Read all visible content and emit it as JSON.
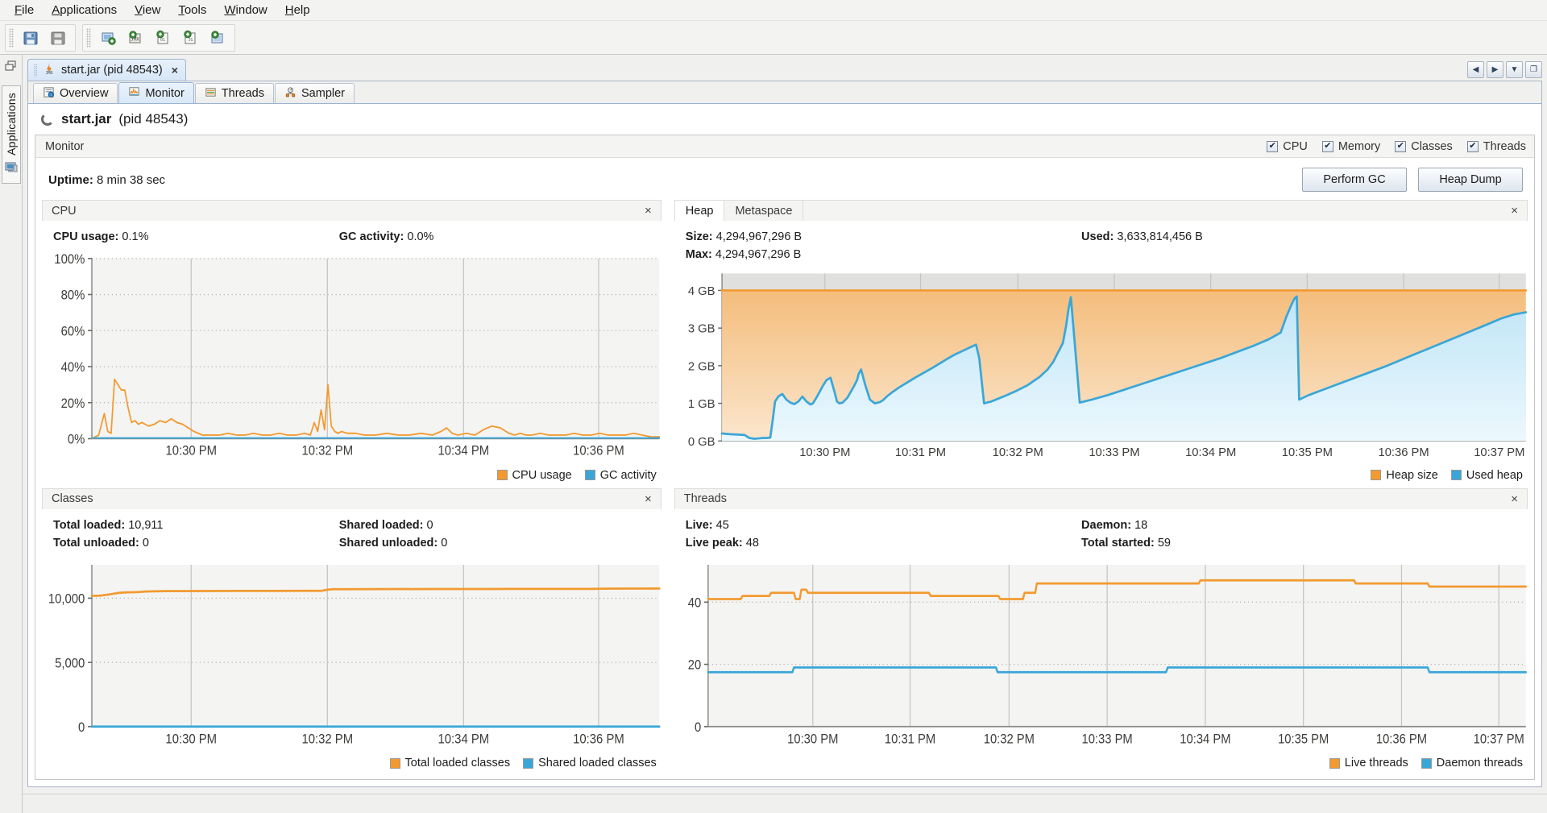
{
  "menu": {
    "items": [
      {
        "label": "File",
        "accel": "F"
      },
      {
        "label": "Applications",
        "accel": "A"
      },
      {
        "label": "View",
        "accel": "V"
      },
      {
        "label": "Tools",
        "accel": "T"
      },
      {
        "label": "Window",
        "accel": "W"
      },
      {
        "label": "Help",
        "accel": "H"
      }
    ]
  },
  "toolbar": {
    "group1": [
      "save-icon",
      "save-all-icon"
    ],
    "group2": [
      "add-local-host-icon",
      "add-jmx-connection-icon",
      "add-remote-host-icon",
      "add-vm-coredump-icon",
      "add-snapshot-icon"
    ]
  },
  "left_rail": {
    "window_icon": "windows-icon",
    "tab_label": "Applications",
    "tab_icon": "computer-icon"
  },
  "doc_tab": {
    "icon": "jmx-icon",
    "label": "start.jar (pid 48543)",
    "close": "×",
    "nav": [
      "◀",
      "▶",
      "▼",
      "❐"
    ]
  },
  "subtabs": [
    {
      "label": "Overview",
      "icon": "overview-icon",
      "active": false
    },
    {
      "label": "Monitor",
      "icon": "monitor-icon",
      "active": true
    },
    {
      "label": "Threads",
      "icon": "threads-icon",
      "active": false
    },
    {
      "label": "Sampler",
      "icon": "sampler-icon",
      "active": false
    }
  ],
  "app_header": {
    "name": "start.jar",
    "pid": "(pid 48543)"
  },
  "monitor": {
    "title": "Monitor",
    "checkboxes": [
      {
        "label": "CPU",
        "checked": true
      },
      {
        "label": "Memory",
        "checked": true
      },
      {
        "label": "Classes",
        "checked": true
      },
      {
        "label": "Threads",
        "checked": true
      }
    ],
    "uptime_label": "Uptime:",
    "uptime_value": "8 min 38 sec",
    "buttons": [
      {
        "label": "Perform GC"
      },
      {
        "label": "Heap Dump"
      }
    ]
  },
  "colors": {
    "orange": "#f29a30",
    "orange_fill": "#f6c98a",
    "blue": "#3aa6d8",
    "blue_fill": "#b8e2f5",
    "grid": "#cfcfcd",
    "plot_bg": "#f4f4f3"
  },
  "cards": {
    "cpu": {
      "title": "CPU",
      "close": "×",
      "stats": [
        {
          "label": "CPU usage:",
          "value": "0.1%"
        },
        {
          "label": "GC activity:",
          "value": "0.0%"
        }
      ]
    },
    "heap": {
      "tabs": [
        {
          "label": "Heap",
          "active": true
        },
        {
          "label": "Metaspace",
          "active": false
        }
      ],
      "close": "×",
      "stats": [
        {
          "label": "Size:",
          "value": "4,294,967,296 B"
        },
        {
          "label": "Max:",
          "value": "4,294,967,296 B"
        },
        {
          "label": "Used:",
          "value": "3,633,814,456 B"
        }
      ]
    },
    "classes": {
      "title": "Classes",
      "close": "×",
      "stats": [
        {
          "label": "Total loaded:",
          "value": "10,911"
        },
        {
          "label": "Total unloaded:",
          "value": "0"
        },
        {
          "label": "Shared loaded:",
          "value": "0"
        },
        {
          "label": "Shared unloaded:",
          "value": "0"
        }
      ]
    },
    "threads": {
      "title": "Threads",
      "close": "×",
      "stats": [
        {
          "label": "Live:",
          "value": "45"
        },
        {
          "label": "Live peak:",
          "value": "48"
        },
        {
          "label": "Daemon:",
          "value": "18"
        },
        {
          "label": "Total started:",
          "value": "59"
        }
      ]
    }
  },
  "chart_data": [
    {
      "id": "cpu",
      "type": "area",
      "title": "CPU",
      "xlabel": "",
      "ylabel": "",
      "ylim": [
        0,
        100
      ],
      "yticks": [
        0,
        20,
        40,
        60,
        80,
        100
      ],
      "yticklabels": [
        "0%",
        "20%",
        "40%",
        "60%",
        "80%",
        "100%"
      ],
      "xticklabels": [
        "10:30 PM",
        "10:32 PM",
        "10:34 PM",
        "10:36 PM"
      ],
      "xtickpos": [
        0.175,
        0.415,
        0.655,
        0.893
      ],
      "grid": true,
      "legend": [
        {
          "name": "CPU usage",
          "color": "#f29a30"
        },
        {
          "name": "GC activity",
          "color": "#3aa6d8"
        }
      ],
      "series": [
        {
          "name": "CPU usage",
          "color": "#f29a30",
          "x": [
            0.0,
            0.012,
            0.022,
            0.028,
            0.034,
            0.04,
            0.046,
            0.052,
            0.058,
            0.064,
            0.07,
            0.076,
            0.082,
            0.088,
            0.094,
            0.1,
            0.11,
            0.12,
            0.13,
            0.14,
            0.15,
            0.16,
            0.17,
            0.18,
            0.195,
            0.21,
            0.225,
            0.24,
            0.255,
            0.27,
            0.285,
            0.3,
            0.315,
            0.33,
            0.345,
            0.36,
            0.375,
            0.385,
            0.392,
            0.398,
            0.404,
            0.41,
            0.416,
            0.422,
            0.428,
            0.434,
            0.44,
            0.45,
            0.465,
            0.48,
            0.5,
            0.52,
            0.54,
            0.56,
            0.58,
            0.6,
            0.615,
            0.625,
            0.635,
            0.645,
            0.66,
            0.675,
            0.69,
            0.705,
            0.72,
            0.735,
            0.745,
            0.755,
            0.765,
            0.775,
            0.79,
            0.805,
            0.82,
            0.835,
            0.85,
            0.865,
            0.88,
            0.895,
            0.91,
            0.925,
            0.94,
            0.955,
            0.97,
            0.985,
            1.0
          ],
          "values": [
            0,
            2,
            14,
            4,
            3,
            33,
            30,
            27,
            27,
            17,
            9,
            10,
            8,
            9,
            8,
            7,
            8,
            10,
            9,
            11,
            9,
            8,
            6,
            4,
            2,
            2,
            2,
            3,
            2,
            2,
            3,
            2,
            2,
            3,
            2,
            2,
            3,
            2,
            9,
            4,
            16,
            5,
            30,
            7,
            4,
            3,
            4,
            3,
            3,
            2,
            2,
            3,
            2,
            2,
            3,
            2,
            4,
            6,
            3,
            2,
            3,
            2,
            5,
            7,
            6,
            3,
            2,
            3,
            2,
            2,
            3,
            2,
            2,
            2,
            3,
            2,
            2,
            3,
            2,
            2,
            2,
            3,
            2,
            1,
            1
          ]
        },
        {
          "name": "GC activity",
          "color": "#3aa6d8",
          "x": [
            0,
            1
          ],
          "values": [
            0.4,
            0.4
          ]
        }
      ]
    },
    {
      "id": "heap",
      "type": "area",
      "title": "Heap",
      "ylim": [
        0,
        4.45
      ],
      "yticks": [
        0,
        1,
        2,
        3,
        4
      ],
      "yticklabels": [
        "0 GB",
        "1 GB",
        "2 GB",
        "3 GB",
        "4 GB"
      ],
      "xticklabels": [
        "10:30 PM",
        "10:31 PM",
        "10:32 PM",
        "10:33 PM",
        "10:34 PM",
        "10:35 PM",
        "10:36 PM",
        "10:37 PM"
      ],
      "xtickpos": [
        0.128,
        0.247,
        0.368,
        0.488,
        0.608,
        0.728,
        0.848,
        0.967
      ],
      "grid": true,
      "legend": [
        {
          "name": "Heap size",
          "color": "#f29a30"
        },
        {
          "name": "Used heap",
          "color": "#3aa6d8"
        }
      ],
      "series": [
        {
          "name": "Heap size",
          "color": "#f29a30",
          "x": [
            0,
            1
          ],
          "values": [
            4.0,
            4.0
          ]
        },
        {
          "name": "Used heap",
          "color": "#3aa6d8",
          "x": [
            0.0,
            0.01,
            0.02,
            0.028,
            0.034,
            0.04,
            0.046,
            0.05,
            0.055,
            0.06,
            0.063,
            0.066,
            0.07,
            0.075,
            0.08,
            0.085,
            0.09,
            0.095,
            0.1,
            0.105,
            0.11,
            0.113,
            0.116,
            0.12,
            0.125,
            0.13,
            0.135,
            0.14,
            0.143,
            0.146,
            0.15,
            0.156,
            0.16,
            0.164,
            0.168,
            0.17,
            0.173,
            0.178,
            0.184,
            0.19,
            0.196,
            0.2,
            0.203,
            0.206,
            0.212,
            0.22,
            0.23,
            0.24,
            0.25,
            0.26,
            0.27,
            0.28,
            0.29,
            0.3,
            0.31,
            0.316,
            0.32,
            0.323,
            0.326,
            0.335,
            0.35,
            0.365,
            0.38,
            0.395,
            0.405,
            0.412,
            0.418,
            0.424,
            0.428,
            0.431,
            0.434,
            0.445,
            0.46,
            0.48,
            0.5,
            0.52,
            0.54,
            0.56,
            0.58,
            0.6,
            0.62,
            0.64,
            0.66,
            0.68,
            0.695,
            0.702,
            0.708,
            0.712,
            0.715,
            0.718,
            0.73,
            0.75,
            0.775,
            0.8,
            0.825,
            0.85,
            0.875,
            0.9,
            0.925,
            0.95,
            0.97,
            0.985,
            1.0
          ],
          "values": [
            0.2,
            0.18,
            0.17,
            0.16,
            0.08,
            0.06,
            0.07,
            0.08,
            0.08,
            0.09,
            0.55,
            1.05,
            1.18,
            1.25,
            1.1,
            1.02,
            0.98,
            1.05,
            1.18,
            1.05,
            0.97,
            1.0,
            1.1,
            1.25,
            1.45,
            1.62,
            1.68,
            1.3,
            1.05,
            1.0,
            1.02,
            1.15,
            1.3,
            1.45,
            1.62,
            1.78,
            1.9,
            1.5,
            1.1,
            1.0,
            1.03,
            1.08,
            1.14,
            1.2,
            1.3,
            1.42,
            1.55,
            1.68,
            1.8,
            1.92,
            2.05,
            2.18,
            2.3,
            2.4,
            2.5,
            2.56,
            2.2,
            1.6,
            1.0,
            1.05,
            1.18,
            1.32,
            1.48,
            1.7,
            1.9,
            2.1,
            2.35,
            2.6,
            3.05,
            3.5,
            3.82,
            1.02,
            1.1,
            1.22,
            1.36,
            1.5,
            1.64,
            1.78,
            1.92,
            2.06,
            2.2,
            2.36,
            2.52,
            2.7,
            2.88,
            3.3,
            3.6,
            3.78,
            3.84,
            1.1,
            1.22,
            1.38,
            1.58,
            1.78,
            1.98,
            2.2,
            2.42,
            2.64,
            2.86,
            3.08,
            3.26,
            3.36,
            3.42
          ]
        }
      ]
    },
    {
      "id": "classes",
      "type": "line",
      "title": "Classes",
      "ylim": [
        0,
        12600
      ],
      "yticks": [
        0,
        5000,
        10000
      ],
      "yticklabels": [
        "0",
        "5,000",
        "10,000"
      ],
      "xticklabels": [
        "10:30 PM",
        "10:32 PM",
        "10:34 PM",
        "10:36 PM"
      ],
      "xtickpos": [
        0.175,
        0.415,
        0.655,
        0.893
      ],
      "grid": true,
      "legend": [
        {
          "name": "Total loaded classes",
          "color": "#f29a30"
        },
        {
          "name": "Shared loaded classes",
          "color": "#3aa6d8"
        }
      ],
      "series": [
        {
          "name": "Total loaded classes",
          "color": "#f29a30",
          "x": [
            0.0,
            0.015,
            0.03,
            0.045,
            0.055,
            0.065,
            0.08,
            0.095,
            0.11,
            0.13,
            0.16,
            0.2,
            0.26,
            0.32,
            0.38,
            0.405,
            0.415,
            0.425,
            0.44,
            0.5,
            0.6,
            0.7,
            0.8,
            0.88,
            0.9,
            0.93,
            1.0
          ],
          "values": [
            10180,
            10200,
            10290,
            10400,
            10440,
            10460,
            10470,
            10520,
            10540,
            10550,
            10555,
            10560,
            10565,
            10570,
            10575,
            10580,
            10660,
            10700,
            10705,
            10710,
            10715,
            10720,
            10722,
            10725,
            10740,
            10750,
            10755
          ]
        },
        {
          "name": "Shared loaded classes",
          "color": "#3aa6d8",
          "x": [
            0,
            1
          ],
          "values": [
            0,
            0
          ]
        }
      ]
    },
    {
      "id": "threads",
      "type": "line",
      "title": "Threads",
      "ylim": [
        0,
        52
      ],
      "yticks": [
        0,
        20,
        40
      ],
      "yticklabels": [
        "0",
        "20",
        "40"
      ],
      "xticklabels": [
        "10:30 PM",
        "10:31 PM",
        "10:32 PM",
        "10:33 PM",
        "10:34 PM",
        "10:35 PM",
        "10:36 PM",
        "10:37 PM"
      ],
      "xtickpos": [
        0.128,
        0.247,
        0.368,
        0.488,
        0.608,
        0.728,
        0.848,
        0.967
      ],
      "grid": true,
      "legend": [
        {
          "name": "Live threads",
          "color": "#f29a30"
        },
        {
          "name": "Daemon threads",
          "color": "#3aa6d8"
        }
      ],
      "series": [
        {
          "name": "Live threads",
          "color": "#f29a30",
          "x": [
            0.0,
            0.04,
            0.042,
            0.075,
            0.077,
            0.105,
            0.107,
            0.112,
            0.114,
            0.12,
            0.122,
            0.24,
            0.242,
            0.27,
            0.272,
            0.33,
            0.332,
            0.355,
            0.357,
            0.37,
            0.372,
            0.385,
            0.387,
            0.4,
            0.402,
            0.56,
            0.562,
            0.6,
            0.602,
            0.76,
            0.762,
            0.79,
            0.792,
            0.88,
            0.882,
            1.0
          ],
          "values": [
            41,
            41,
            42,
            42,
            43,
            43,
            41,
            41,
            44,
            44,
            43,
            43,
            43,
            43,
            42,
            42,
            42,
            42,
            41,
            41,
            41,
            41,
            43,
            43,
            46,
            46,
            46,
            46,
            47,
            47,
            47,
            47,
            46,
            46,
            45,
            45
          ]
        },
        {
          "name": "Daemon threads",
          "color": "#3aa6d8",
          "x": [
            0.0,
            0.103,
            0.105,
            0.352,
            0.354,
            0.56,
            0.562,
            0.88,
            0.882,
            1.0
          ],
          "values": [
            17.5,
            17.5,
            19,
            19,
            17.5,
            17.5,
            19,
            19,
            17.5,
            17.5
          ]
        }
      ]
    }
  ]
}
